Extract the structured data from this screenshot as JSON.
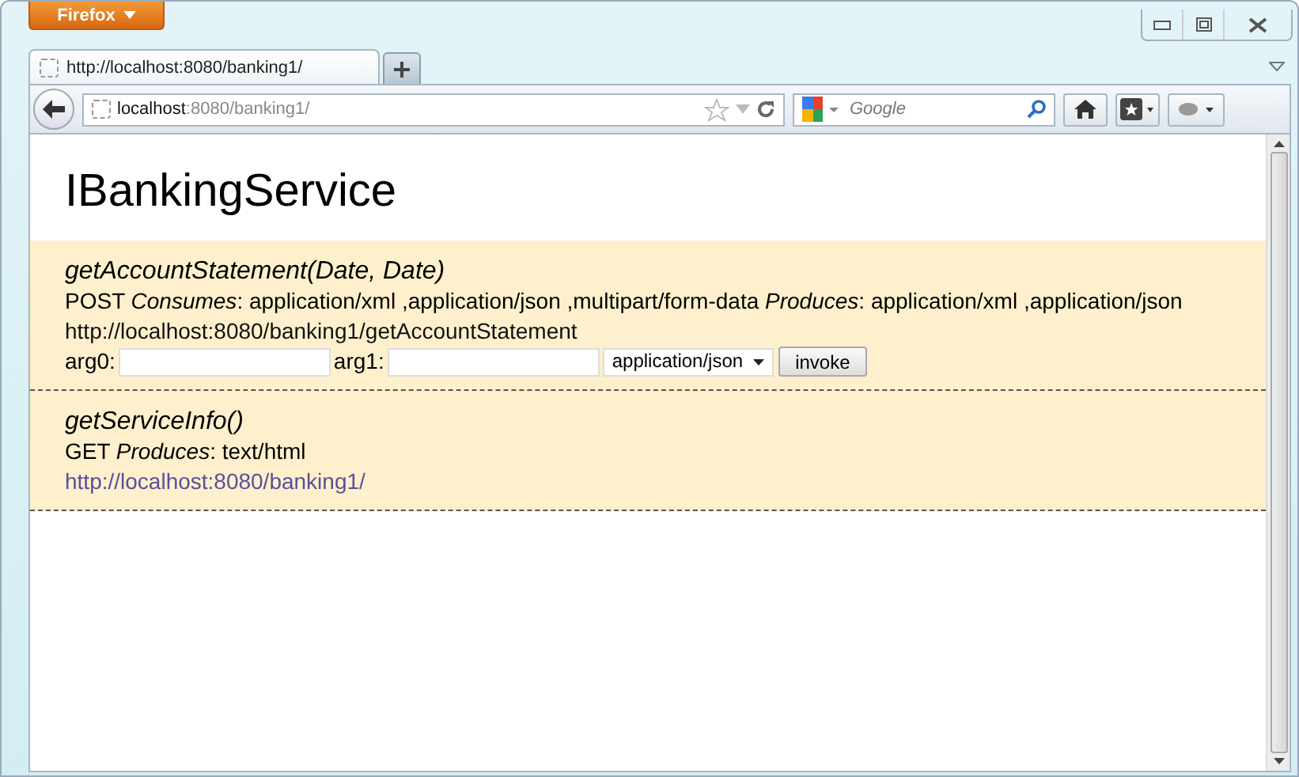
{
  "browser": {
    "menu_button": "Firefox",
    "tabs": [
      {
        "title": "http://localhost:8080/banking1/",
        "selected": true
      }
    ],
    "address": {
      "host": "localhost",
      "rest": ":8080/banking1/"
    },
    "search": {
      "placeholder": "Google"
    }
  },
  "page": {
    "title": "IBankingService",
    "operations": [
      {
        "signature": "getAccountStatement(Date, Date)",
        "description": "POST *Consumes*: application/xml ,application/json ,multipart/form-data *Produces*: application/xml ,application/json",
        "url": {
          "kind": "text",
          "text": "http://localhost:8080/banking1/getAccountStatement"
        },
        "form": {
          "args": [
            {
              "label": "arg0:"
            },
            {
              "label": "arg1:"
            }
          ],
          "format": "application/json",
          "button": "invoke"
        }
      },
      {
        "signature": "getServiceInfo()",
        "description": "GET *Produces*: text/html",
        "url": {
          "kind": "link",
          "text": "http://localhost:8080/banking1/"
        }
      }
    ]
  }
}
